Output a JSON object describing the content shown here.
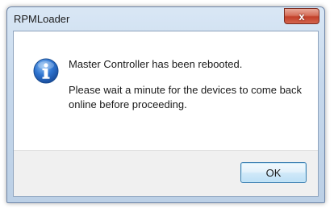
{
  "window": {
    "title": "RPMLoader",
    "close_symbol": "x"
  },
  "message": {
    "line1": "Master Controller has been rebooted.",
    "line2": "Please wait a minute for the devices to come back online before proceeding."
  },
  "buttons": {
    "ok_label": "OK"
  },
  "icons": {
    "message_icon": "info-icon",
    "close_icon": "close-icon"
  },
  "colors": {
    "info_icon_blue": "#1f5fbf",
    "close_red": "#c2402a"
  }
}
